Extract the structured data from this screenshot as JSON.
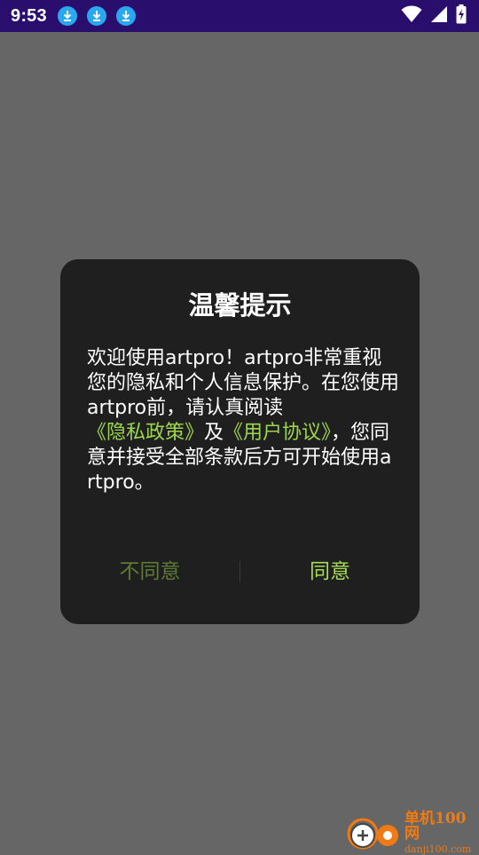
{
  "status_bar": {
    "time": "9:53",
    "icons": [
      "download-icon",
      "download-icon",
      "download-icon",
      "wifi-icon",
      "signal-icon",
      "battery-charging-icon"
    ]
  },
  "dialog": {
    "title": "温馨提示",
    "body_parts": [
      "欢迎使用artpro！artpro非常重视您的隐私和个人信息保护。在您使用artpro前，请认真阅读",
      "《隐私政策》",
      "及",
      "《用户协议》",
      "，您同意并接受全部条款后方可开始使用artpro。"
    ],
    "disagree_label": "不同意",
    "agree_label": "同意"
  },
  "watermark": {
    "cn": "单机100网",
    "en": "danji100.com"
  },
  "colors": {
    "status_bar_bg": "#2a0e6e",
    "backdrop": "#666666",
    "dialog_bg": "#1f1f1f",
    "link": "#9ed64a",
    "agree": "#a6dc53",
    "disagree": "#5f7a35",
    "watermark": "#f07a14"
  }
}
